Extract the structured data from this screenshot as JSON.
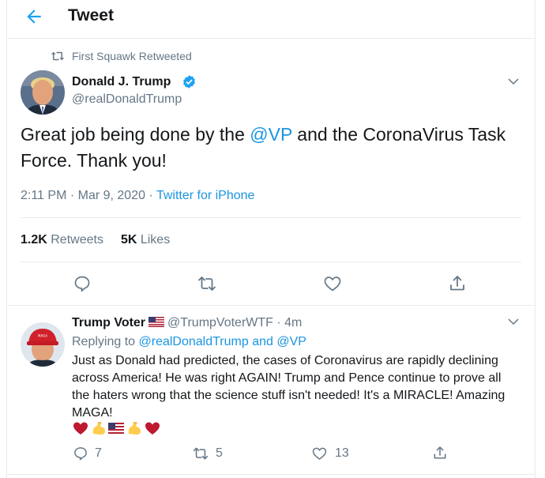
{
  "header": {
    "title": "Tweet"
  },
  "retweet_context": {
    "text": "First Squawk Retweeted"
  },
  "tweet": {
    "author_name": "Donald J. Trump",
    "author_handle": "@realDonaldTrump",
    "text_part1": "Great job being done by the ",
    "mention": "@VP",
    "text_part2": " and the CoronaVirus Task Force. Thank you!",
    "time": "2:11 PM · Mar 9, 2020 · ",
    "source": "Twitter for iPhone",
    "retweets_count": "1.2K",
    "retweets_label": " Retweets",
    "likes_count": "5K",
    "likes_label": " Likes"
  },
  "reply": {
    "author_name": "Trump Voter",
    "author_handle": "@TrumpVoterWTF",
    "time": " · 4m",
    "replying_prefix": "Replying to ",
    "replying_to_1": "@realDonaldTrump",
    "replying_and": " and ",
    "replying_to_2": "@VP",
    "text": "Just as Donald had predicted, the cases of Coronavirus are rapidly declining across America! He was right AGAIN! Trump and Pence continue to prove all the haters wrong that the science stuff isn't needed! It's a MIRACLE! Amazing MAGA!",
    "reply_count": "7",
    "retweet_count": "5",
    "like_count": "13"
  },
  "colors": {
    "link": "#1b95e0",
    "muted": "#657786",
    "divider": "#e6ecf0",
    "verified": "#1da1f2"
  },
  "icons": [
    "back-arrow-icon",
    "retweet-icon",
    "verified-badge-icon",
    "chevron-down-icon",
    "reply-icon",
    "like-icon",
    "share-icon",
    "us-flag-icon",
    "heart-emoji",
    "flexed-biceps-emoji"
  ]
}
